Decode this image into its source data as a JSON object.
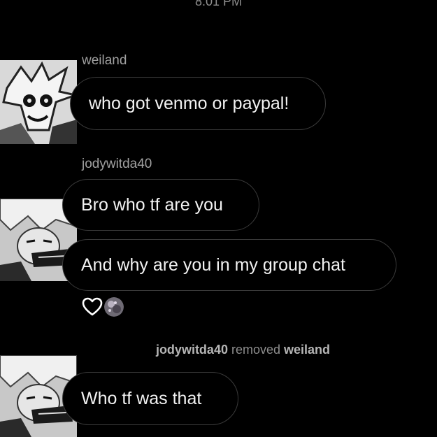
{
  "status": {
    "time": "8:01 PM"
  },
  "messages": [
    {
      "sender": "weiland",
      "text": "who got venmo or paypal!"
    },
    {
      "sender": "jodywitda40",
      "texts": [
        "Bro who tf are you",
        "And why are you in my group chat"
      ]
    },
    {
      "text": "Who tf was that"
    }
  ],
  "reactions": {
    "icons": [
      "heart-outline-icon",
      "reactor-avatar"
    ]
  },
  "system_message": {
    "actor": "jodywitda40",
    "action": "removed",
    "target": "weiland"
  },
  "colors": {
    "background": "#000000",
    "bubble_border": "#3a3a3a",
    "meta_text": "#8e8e8e"
  }
}
